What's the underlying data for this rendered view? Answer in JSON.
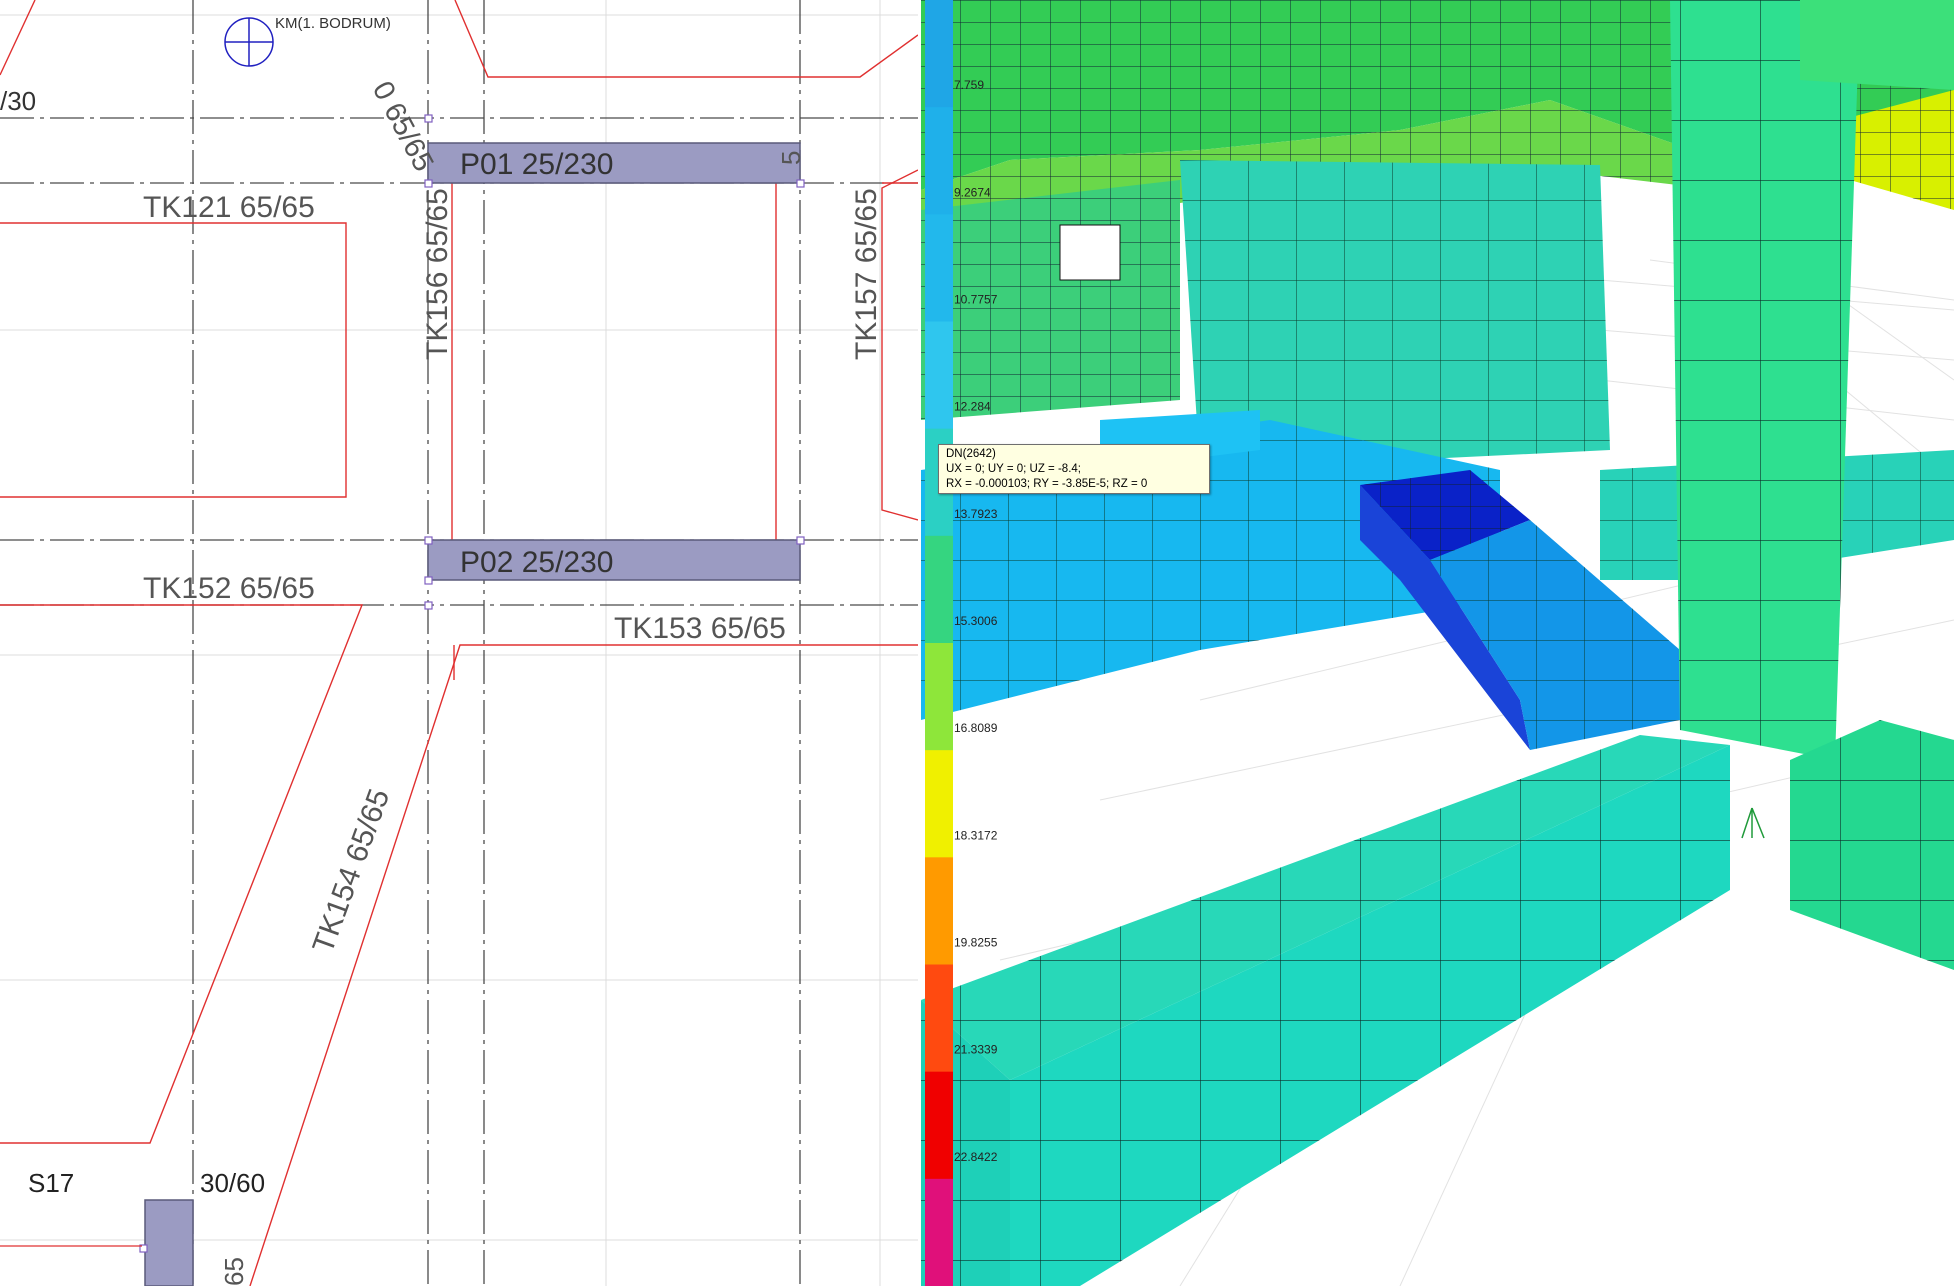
{
  "plan": {
    "node_label": "KM(1. BODRUM)",
    "frag_top": "0 65/65",
    "frag_left": "/30",
    "tk121": "TK121 65/65",
    "tk152": "TK152 65/65",
    "tk153": "TK153 65/65",
    "tk154": "TK154 65/65",
    "tk156": "TK156 65/65",
    "tk157": "TK157 65/65",
    "p01": "P01 25/230",
    "p02": "P02 25/230",
    "s17": "S17",
    "s17_size": "30/60",
    "frag_bottom": "65",
    "frag_p01": "5",
    "colors": {
      "beam_line": "#e03030",
      "axis_line": "#4a4a4a",
      "column_fill": "#9b9bc2",
      "grid_line": "#dcdcdc"
    }
  },
  "legend": {
    "values": [
      "7.759",
      "9.2674",
      "10.7757",
      "12.284",
      "13.7923",
      "15.3006",
      "16.8089",
      "18.3172",
      "19.8255",
      "21.3339",
      "22.8422"
    ],
    "colors": [
      "#1fa6e6",
      "#1fb0ea",
      "#22b8ec",
      "#2fc6ee",
      "#2bd0c4",
      "#35d580",
      "#8ee63a",
      "#f0f000",
      "#ff9a00",
      "#ff4a10",
      "#f00000",
      "#e0107a"
    ]
  },
  "tooltip": {
    "line1": "DN(2642)",
    "line2": "UX = 0; UY = 0; UZ = -8.4;",
    "line3": "RX = -0.000103; RY = -3.85E-5; RZ = 0"
  }
}
